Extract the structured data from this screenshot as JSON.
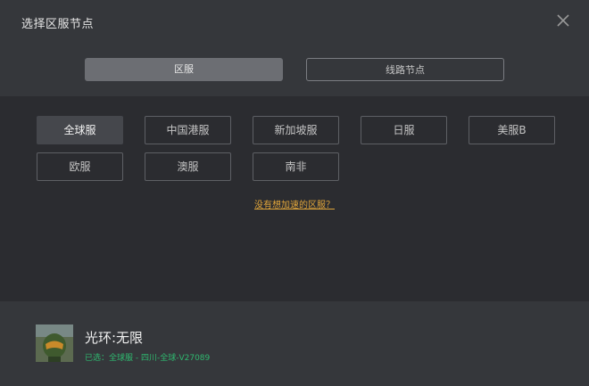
{
  "window": {
    "title": "选择区服节点"
  },
  "tabs": [
    {
      "label": "区服",
      "active": true
    },
    {
      "label": "线路节点",
      "active": false
    }
  ],
  "regions": [
    {
      "label": "全球服",
      "selected": true
    },
    {
      "label": "中国港服",
      "selected": false
    },
    {
      "label": "新加坡服",
      "selected": false
    },
    {
      "label": "日服",
      "selected": false
    },
    {
      "label": "美服B",
      "selected": false
    },
    {
      "label": "欧服",
      "selected": false
    },
    {
      "label": "澳服",
      "selected": false
    },
    {
      "label": "南非",
      "selected": false
    }
  ],
  "hint": {
    "text": "没有想加速的区服？"
  },
  "game": {
    "name": "光环:无限",
    "selected_text": "已选：全球服 - 四川-全球-V27089"
  },
  "colors": {
    "accent_link": "#e0a53a",
    "status_green": "#2fb86f",
    "background": "#2b2c30",
    "panel": "#35373b"
  },
  "icons": {
    "close": "close-icon",
    "avatar": "game-avatar"
  }
}
